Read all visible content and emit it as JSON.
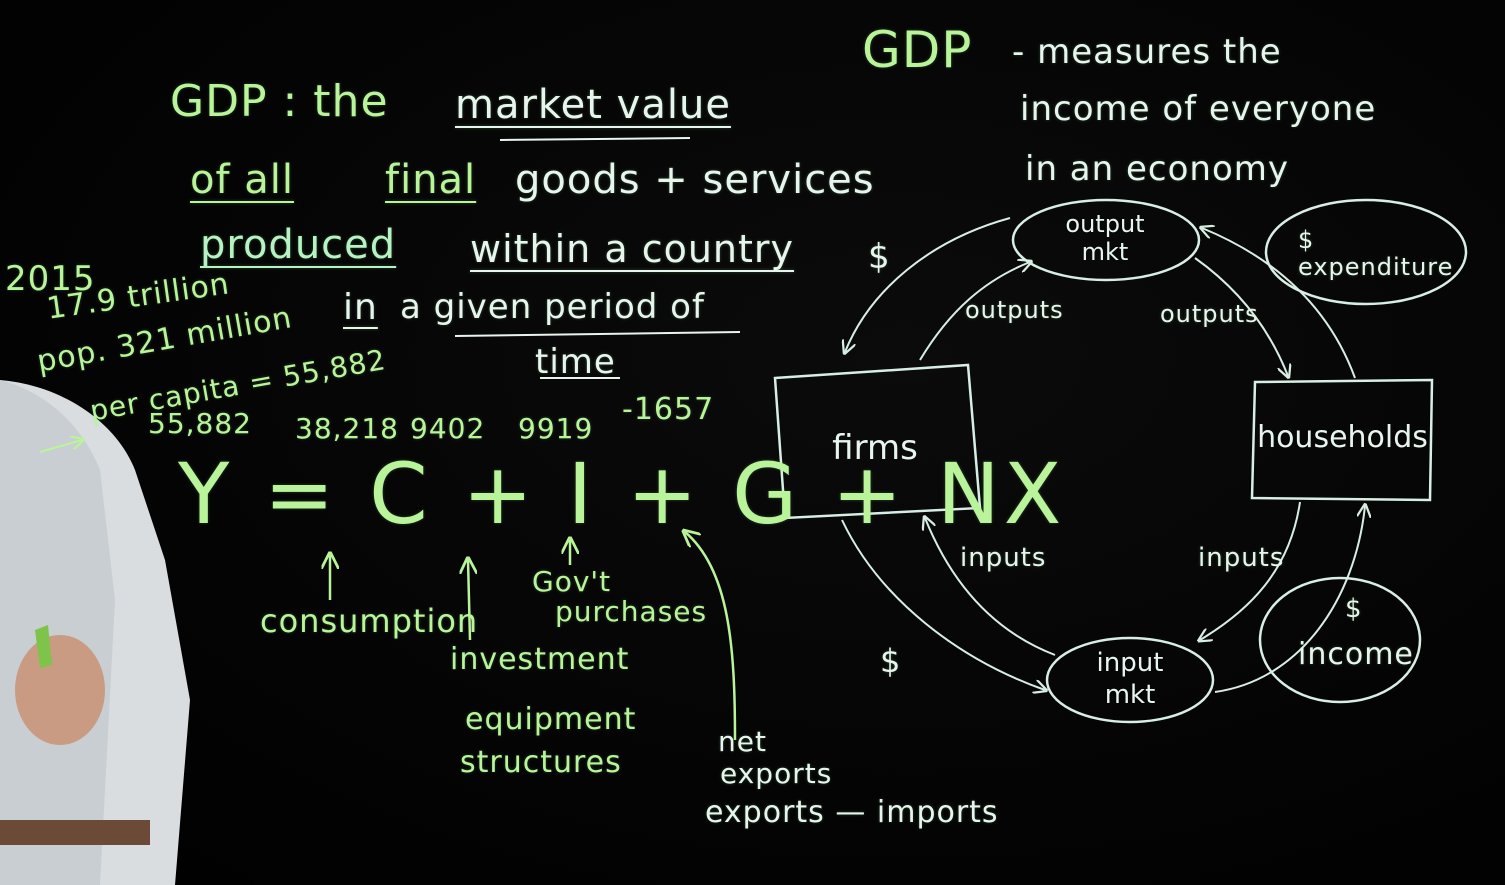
{
  "colors": {
    "board": "#000000",
    "green_chalk": "#b9f39a",
    "mint_chalk": "#b6f2c4",
    "white_chalk": "#e8f5ef"
  },
  "definition": {
    "line1_lead": "GDP : the",
    "line1_term": "market value",
    "line2_of_all": "of all",
    "line2_final": "final",
    "line2_goods": "goods + services",
    "line3_produced": "produced",
    "line3_within": "within a country",
    "line3_dollar": "$",
    "line4_in": "in",
    "line4_period": "a given period of",
    "line5_time": "time"
  },
  "income_note": {
    "title": "GDP",
    "line1": "- measures the",
    "line2": "income of everyone",
    "line3": "in an economy"
  },
  "stats_2015": {
    "year": "2015",
    "gdp": "17.9 trillion",
    "population": "pop. 321 million",
    "per_capita": "per capita = 55,882",
    "arrow": "→"
  },
  "equation": {
    "y_value": "55,882",
    "c_value": "38,218",
    "i_value": "9402",
    "g_value": "9919",
    "nx_value": "-1657",
    "formula": "Y = C + I + G + NX"
  },
  "components": {
    "consumption": "consumption",
    "investment": "investment",
    "investment_detail_1": "equipment",
    "investment_detail_2": "structures",
    "government_1": "Gov't",
    "government_2": "purchases",
    "net_exports_1": "net",
    "net_exports_2": "exports",
    "net_exports_3": "exports — imports"
  },
  "circular_flow": {
    "firms": "firms",
    "households": "households",
    "output_market_1": "output",
    "output_market_2": "mkt",
    "input_market_1": "input",
    "input_market_2": "mkt",
    "outputs_left": "outputs",
    "outputs_right": "outputs",
    "inputs_left": "inputs",
    "inputs_right": "inputs",
    "dollar_expenditure": "$",
    "expenditure": "expenditure",
    "dollar_income": "$",
    "income": "income",
    "dollar_left": "$",
    "dollar_top_left": "$"
  }
}
